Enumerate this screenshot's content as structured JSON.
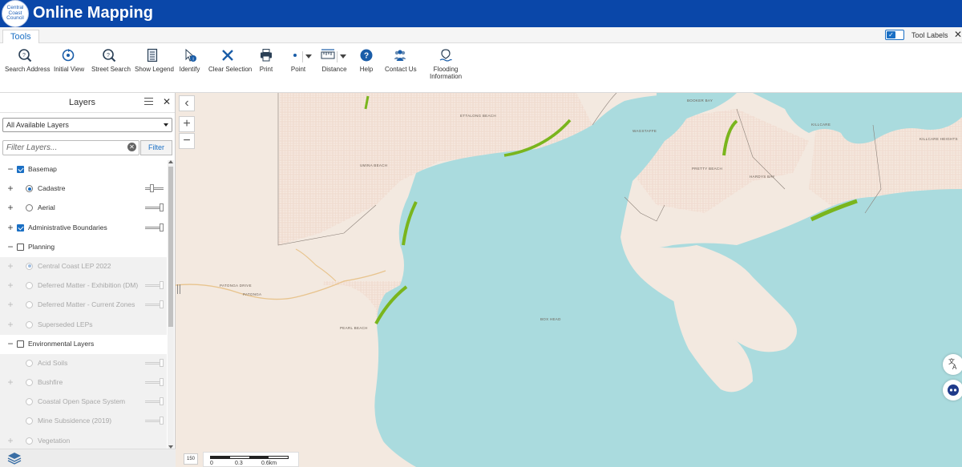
{
  "header": {
    "logo_text": "Central Coast Council",
    "app_title": "Online Mapping",
    "brand_color": "#0a47a9"
  },
  "tabbar": {
    "tab_label": "Tools",
    "toggle_label": "Tool Labels",
    "toggle_on": true,
    "close_icon": "close-icon"
  },
  "toolbar": {
    "tools": [
      {
        "label": "Search Address",
        "icon": "search-address-icon"
      },
      {
        "label": "Initial View",
        "icon": "initial-view-icon"
      },
      {
        "label": "Street Search",
        "icon": "street-search-icon"
      },
      {
        "label": "Show Legend",
        "icon": "legend-icon"
      },
      {
        "label": "Identify",
        "icon": "identify-icon"
      },
      {
        "label": "Clear Selection",
        "icon": "clear-selection-icon"
      },
      {
        "label": "Print",
        "icon": "print-icon"
      },
      {
        "label": "Point",
        "icon": "point-icon"
      },
      {
        "label": "Distance",
        "icon": "distance-icon"
      },
      {
        "label": "Help",
        "icon": "help-icon"
      },
      {
        "label": "Contact Us",
        "icon": "contact-icon"
      },
      {
        "label": "Flooding",
        "label2": "Information",
        "icon": "flooding-icon"
      }
    ]
  },
  "layers_panel": {
    "title": "Layers",
    "selected_option": "All Available Layers",
    "filter_placeholder": "Filter Layers...",
    "filter_button": "Filter",
    "rows": [
      {
        "label": "Basemap",
        "kind": "group",
        "checked": true,
        "expander": "−"
      },
      {
        "label": "Cadastre",
        "kind": "sub",
        "selected": true,
        "expander": "+"
      },
      {
        "label": "Aerial",
        "kind": "sub",
        "selected": false,
        "expander": "+"
      },
      {
        "label": "Administrative Boundaries",
        "kind": "group",
        "checked": true,
        "expander": "+"
      },
      {
        "label": "Planning",
        "kind": "group",
        "checked": false,
        "expander": "−"
      },
      {
        "label": "Central Coast LEP 2022",
        "kind": "sub-dim",
        "selected": true,
        "expander": "+"
      },
      {
        "label": "Deferred Matter - Exhibition (DM)",
        "kind": "sub-dim",
        "selected": false,
        "expander": "+"
      },
      {
        "label": "Deferred Matter - Current Zones",
        "kind": "sub-dim",
        "selected": false,
        "expander": "+"
      },
      {
        "label": "Superseded LEPs",
        "kind": "sub-dim",
        "selected": false,
        "expander": "+"
      },
      {
        "label": "Environmental Layers",
        "kind": "group",
        "checked": false,
        "expander": "−"
      },
      {
        "label": "Acid Soils",
        "kind": "sub-dim",
        "selected": false,
        "expander": ""
      },
      {
        "label": "Bushfire",
        "kind": "sub-dim",
        "selected": false,
        "expander": "+"
      },
      {
        "label": "Coastal Open Space System",
        "kind": "sub-dim",
        "selected": false,
        "expander": ""
      },
      {
        "label": "Mine Subsidence (2019)",
        "kind": "sub-dim",
        "selected": false,
        "expander": ""
      },
      {
        "label": "Vegetation",
        "kind": "sub-dim",
        "selected": false,
        "expander": "+"
      }
    ]
  },
  "map": {
    "water_color": "#aadbde",
    "land_color": "#f3e9e0",
    "highlight_color": "#7ab51d",
    "place_labels": [
      "BOOKER BAY",
      "KILLCARE",
      "WAGSTAFFE",
      "PRETTY BEACH",
      "HARDYS BAY",
      "PATONGA",
      "BOX HEAD",
      "ETTALONG BEACH",
      "UMINA BEACH",
      "PEARL BEACH",
      "KILLCARE HEIGHTS",
      "PATONGA DRIVE"
    ],
    "scale_labels": [
      "0",
      "0.3",
      "0.6km"
    ],
    "scale_icon_text": "150"
  }
}
